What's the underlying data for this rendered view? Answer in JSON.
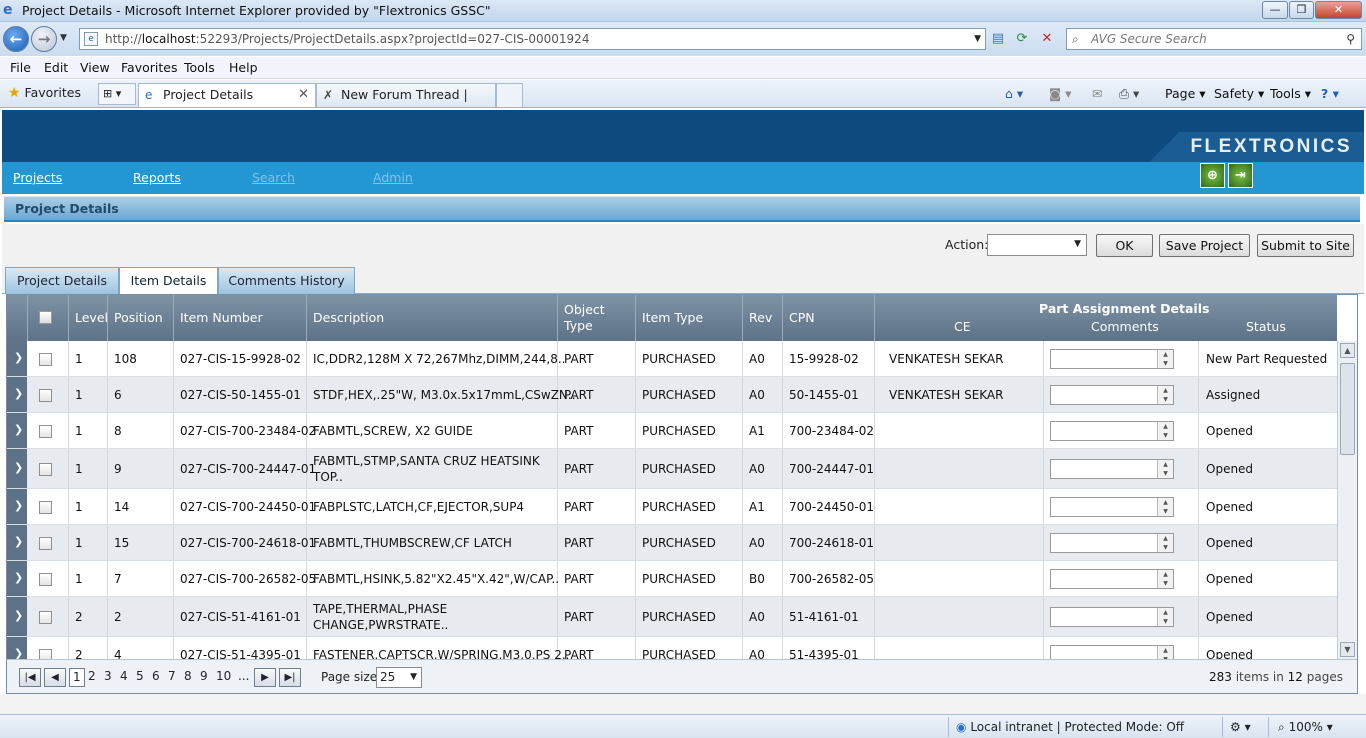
{
  "window": {
    "title": "Project Details - Microsoft Internet Explorer provided by \"Flextronics GSSC\"",
    "minimize": "—",
    "maximize": "❐",
    "close": "✕"
  },
  "address": {
    "url_prefix": "http://",
    "url_host": "localhost",
    "url_rest": ":52293/Projects/ProjectDetails.aspx?projectId=027-CIS-00001924",
    "search_placeholder": "AVG Secure Search"
  },
  "menu": [
    "File",
    "Edit",
    "View",
    "Favorites",
    "Tools",
    "Help"
  ],
  "favorites_label": "Favorites",
  "browser_tabs": [
    {
      "label": "Project Details",
      "close": "✕"
    },
    {
      "label": "New Forum Thread | Telerik"
    }
  ],
  "command_bar": [
    "Page",
    "Safety",
    "Tools"
  ],
  "brand": "FLEXTRONICS",
  "app_nav": {
    "projects": "Projects",
    "reports": "Reports",
    "search": "Search",
    "admin": "Admin"
  },
  "section_title": "Project Details",
  "action_bar": {
    "action_label": "Action:",
    "action_value": "",
    "ok": "OK",
    "save": "Save Project",
    "submit": "Submit to Site"
  },
  "page_tabs": [
    "Project Details",
    "Item Details",
    "Comments History"
  ],
  "grid": {
    "headers": {
      "level": "Level",
      "position": "Position",
      "item_number": "Item Number",
      "description": "Description",
      "object_type": "Object Type",
      "item_type": "Item Type",
      "rev": "Rev",
      "cpn": "CPN",
      "group": "Part Assignment Details",
      "ce": "CE",
      "comments": "Comments",
      "status": "Status"
    },
    "rows": [
      {
        "level": "1",
        "position": "108",
        "item_number": "027-CIS-15-9928-02",
        "description": "IC,DDR2,128M X 72,267Mhz,DIMM,244,8..",
        "object_type": "PART",
        "item_type": "PURCHASED",
        "rev": "A0",
        "cpn": "15-9928-02",
        "ce": "VENKATESH SEKAR",
        "comments": "",
        "status": "New Part Requested"
      },
      {
        "level": "1",
        "position": "6",
        "item_number": "027-CIS-50-1455-01",
        "description": "STDF,HEX,.25\"W, M3.0x.5x17mmL,CSwZN..",
        "object_type": "PART",
        "item_type": "PURCHASED",
        "rev": "A0",
        "cpn": "50-1455-01",
        "ce": "VENKATESH SEKAR",
        "comments": "",
        "status": "Assigned"
      },
      {
        "level": "1",
        "position": "8",
        "item_number": "027-CIS-700-23484-02",
        "description": "FABMTL,SCREW, X2 GUIDE",
        "object_type": "PART",
        "item_type": "PURCHASED",
        "rev": "A1",
        "cpn": "700-23484-02",
        "ce": "",
        "comments": "",
        "status": "Opened"
      },
      {
        "level": "1",
        "position": "9",
        "item_number": "027-CIS-700-24447-01",
        "description": "FABMTL,STMP,SANTA CRUZ HEATSINK TOP..",
        "object_type": "PART",
        "item_type": "PURCHASED",
        "rev": "A0",
        "cpn": "700-24447-01",
        "ce": "",
        "comments": "",
        "status": "Opened"
      },
      {
        "level": "1",
        "position": "14",
        "item_number": "027-CIS-700-24450-01",
        "description": "FABPLSTC,LATCH,CF,EJECTOR,SUP4",
        "object_type": "PART",
        "item_type": "PURCHASED",
        "rev": "A1",
        "cpn": "700-24450-01",
        "ce": "",
        "comments": "",
        "status": "Opened"
      },
      {
        "level": "1",
        "position": "15",
        "item_number": "027-CIS-700-24618-01",
        "description": "FABMTL,THUMBSCREW,CF LATCH",
        "object_type": "PART",
        "item_type": "PURCHASED",
        "rev": "A0",
        "cpn": "700-24618-01",
        "ce": "",
        "comments": "",
        "status": "Opened"
      },
      {
        "level": "1",
        "position": "7",
        "item_number": "027-CIS-700-26582-05",
        "description": "FABMTL,HSINK,5.82\"X2.45\"X.42\",W/CAP..",
        "object_type": "PART",
        "item_type": "PURCHASED",
        "rev": "B0",
        "cpn": "700-26582-05",
        "ce": "",
        "comments": "",
        "status": "Opened"
      },
      {
        "level": "2",
        "position": "2",
        "item_number": "027-CIS-51-4161-01",
        "description": "TAPE,THERMAL,PHASE CHANGE,PWRSTRATE..",
        "object_type": "PART",
        "item_type": "PURCHASED",
        "rev": "A0",
        "cpn": "51-4161-01",
        "ce": "",
        "comments": "",
        "status": "Opened"
      },
      {
        "level": "2",
        "position": "4",
        "item_number": "027-CIS-51-4395-01",
        "description": "FASTENER,CAPTSCR,W/SPRING,M3.0,PS 2..",
        "object_type": "PART",
        "item_type": "PURCHASED",
        "rev": "A0",
        "cpn": "51-4395-01",
        "ce": "",
        "comments": "",
        "status": "Opened"
      }
    ]
  },
  "pager": {
    "pages": [
      "1",
      "2",
      "3",
      "4",
      "5",
      "6",
      "7",
      "8",
      "9",
      "10",
      "..."
    ],
    "current": "1",
    "page_size_label": "Page size:",
    "page_size": "25",
    "total_items": "283",
    "items_in": "items in",
    "total_pages": "12",
    "pages_label": "pages"
  },
  "status": {
    "zone": "Local intranet | Protected Mode: Off",
    "zoom": "100%"
  }
}
